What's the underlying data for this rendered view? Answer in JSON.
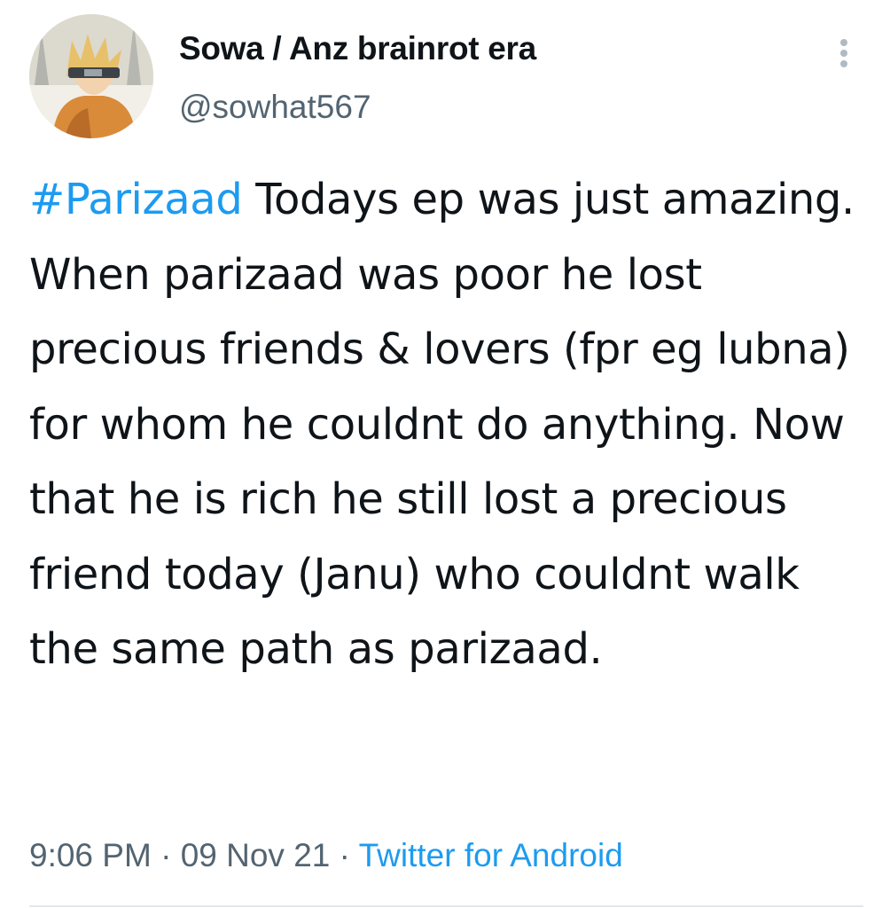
{
  "user": {
    "display_name": "Sowa / Anz brainrot era",
    "handle": "@sowhat567",
    "avatar_icon": "anime-avatar"
  },
  "more_icon": "more-vertical-icon",
  "tweet": {
    "hashtag": "#Parizaad",
    "body": " Todays ep was just amazing. When parizaad was poor he lost precious friends & lovers (fpr eg lubna) for whom he couldnt do anything. Now that he is rich he still lost a precious friend today (Janu) who couldnt walk the same path as parizaad."
  },
  "meta": {
    "time": "9:06 PM",
    "separator": "·",
    "date": "09 Nov 21",
    "source": "Twitter for Android"
  },
  "colors": {
    "link": "#1d9bf0",
    "text": "#0f1419",
    "secondary": "#536471"
  }
}
